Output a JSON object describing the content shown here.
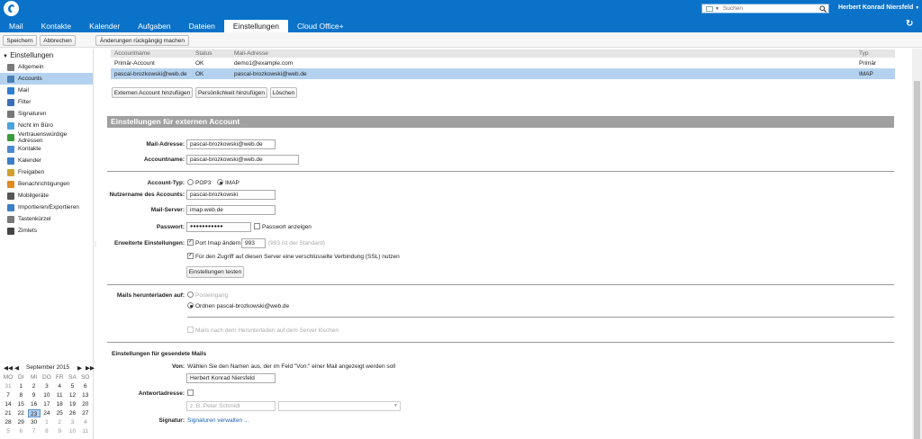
{
  "nav": {
    "tabs": [
      "Mail",
      "Kontakte",
      "Kalender",
      "Aufgaben",
      "Dateien",
      "Einstellungen",
      "Cloud Office+"
    ],
    "search_placeholder": "Suchen",
    "user": "Herbert Konrad Niersfeld"
  },
  "toolbar": {
    "save": "Speichern",
    "cancel": "Abbrechen",
    "undo": "Änderungen rückgängig machen"
  },
  "sidebar": {
    "title": "Einstellungen",
    "items": [
      {
        "label": "Allgemein",
        "color": "#7a7a7a"
      },
      {
        "label": "Accounts",
        "color": "#4a7fb5"
      },
      {
        "label": "Mail",
        "color": "#2a7fd1"
      },
      {
        "label": "Filter",
        "color": "#3a6fb8"
      },
      {
        "label": "Signaturen",
        "color": "#777777"
      },
      {
        "label": "Nicht im Büro",
        "color": "#4aa3df"
      },
      {
        "label": "Vertrauenswürdige Adressen",
        "color": "#3a9b3a"
      },
      {
        "label": "Kontakte",
        "color": "#4a8ad0"
      },
      {
        "label": "Kalender",
        "color": "#3a7fc8"
      },
      {
        "label": "Freigaben",
        "color": "#d0a030"
      },
      {
        "label": "Benachrichtigungen",
        "color": "#e08a20"
      },
      {
        "label": "Mobilgeräte",
        "color": "#555555"
      },
      {
        "label": "Importieren/Exportieren",
        "color": "#3a7fc8"
      },
      {
        "label": "Tastenkürzel",
        "color": "#777777"
      },
      {
        "label": "Zimlets",
        "color": "#444444"
      }
    ],
    "selected": 1
  },
  "calendar": {
    "month": "September 2015",
    "weekdays": [
      "MO",
      "DI",
      "MI",
      "DO",
      "FR",
      "SA",
      "SO"
    ],
    "weeks": [
      [
        "31",
        "1",
        "2",
        "3",
        "4",
        "5",
        "6"
      ],
      [
        "7",
        "8",
        "9",
        "10",
        "11",
        "12",
        "13"
      ],
      [
        "14",
        "15",
        "16",
        "17",
        "18",
        "19",
        "20"
      ],
      [
        "21",
        "22",
        "23",
        "24",
        "25",
        "26",
        "27"
      ],
      [
        "28",
        "29",
        "30",
        "1",
        "2",
        "3",
        "4"
      ],
      [
        "5",
        "6",
        "7",
        "8",
        "9",
        "10",
        "11"
      ]
    ],
    "today": "23"
  },
  "accounts": {
    "headers": [
      "Accountname",
      "Status",
      "Mail-Adresse",
      "Typ"
    ],
    "rows": [
      [
        "Primär-Account",
        "OK",
        "demo1@example.com",
        "Primär"
      ],
      [
        "pascal-brozkowski@web.de",
        "OK",
        "pascal-brozkowski@web.de",
        "IMAP"
      ]
    ],
    "buttons": [
      "Externen Account hinzufügen",
      "Persönlichkeit hinzufügen",
      "Löschen"
    ]
  },
  "external": {
    "section": "Einstellungen für externen Account",
    "mail_label": "Mail-Adresse:",
    "mail_value": "pascal-brozkowski@web.de",
    "accname_label": "Accountname:",
    "accname_value": "pascal-brozkowski@web.de",
    "type_label": "Account-Typ:",
    "pop3": "POP3",
    "imap": "IMAP",
    "user_label": "Nutzername des Accounts:",
    "user_value": "pascal-brozkowski",
    "server_label": "Mail-Server:",
    "server_value": "imap.web.de",
    "pass_label": "Passwort:",
    "pass_value": "●●●●●●●●●●●",
    "show_pass": "Passwort anzeigen",
    "adv_label": "Erweiterte Einstellungen:",
    "port_label": "Port Imap ändern",
    "port_value": "993",
    "port_hint": "(993 ist der Standard)",
    "ssl": "Für den Zugriff auf diesen Server eine verschlüsselte Verbindung (SSL) nutzen",
    "test_btn": "Einstellungen testen",
    "download_label": "Mails herunterladen auf:",
    "inbox": "Posteingang",
    "folder": "Ordnen pascal-brozkowski@web.de",
    "delete_after": "Mails nach dem Herunterladen auf dem Server löschen"
  },
  "sent": {
    "section": "Einstellungen für gesendete Mails",
    "from_label": "Von:",
    "from_hint": "Wählen Sie den Namen aus, der im Feld \"Von:\" einer Mail angezeigt werden soll",
    "from_value": "Herbert Konrad Niersfeld",
    "reply_label": "Antwortadresse:",
    "reply_placeholder": "z. B. Peter Schmidt",
    "sig_label": "Signatur:",
    "sig_link": "Signaturen verwalten ..."
  }
}
